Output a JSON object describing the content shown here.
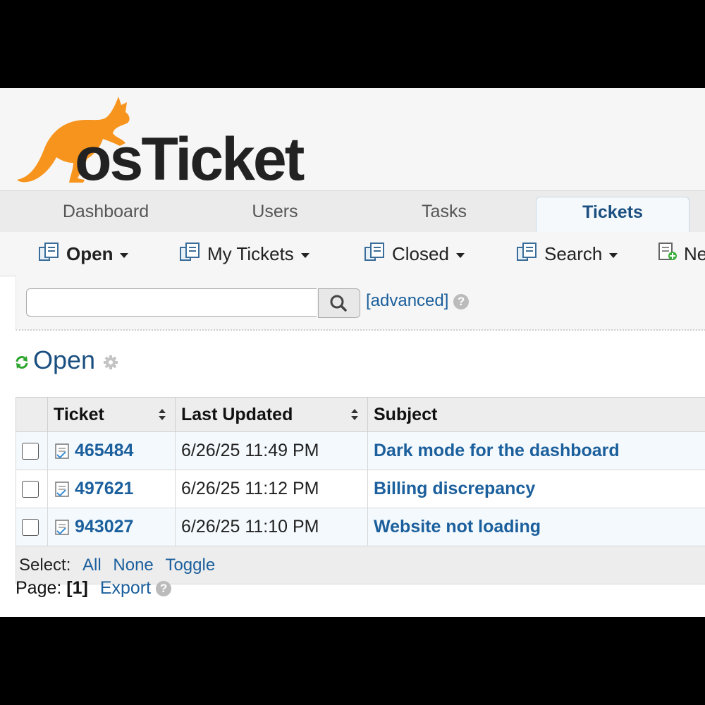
{
  "app": {
    "logo_text": "osTicket"
  },
  "tabs": [
    {
      "label": "Dashboard"
    },
    {
      "label": "Users"
    },
    {
      "label": "Tasks"
    },
    {
      "label": "Tickets",
      "active": true
    }
  ],
  "subnav": [
    {
      "label": "Open",
      "icon": "tickets-icon",
      "bold": true
    },
    {
      "label": "My Tickets",
      "icon": "tickets-icon"
    },
    {
      "label": "Closed",
      "icon": "tickets-icon"
    },
    {
      "label": "Search",
      "icon": "tickets-icon"
    },
    {
      "label": "Ne",
      "icon": "new-ticket-icon"
    }
  ],
  "search": {
    "placeholder": "",
    "advanced_label": "[advanced]",
    "help": "?"
  },
  "queue": {
    "title": "Open"
  },
  "table": {
    "columns": [
      "Ticket",
      "Last Updated",
      "Subject"
    ],
    "rows": [
      {
        "ticket": "465484",
        "updated": "6/26/25 11:49 PM",
        "subject": "Dark mode for the dashboard"
      },
      {
        "ticket": "497621",
        "updated": "6/26/25 11:12 PM",
        "subject": "Billing discrepancy"
      },
      {
        "ticket": "943027",
        "updated": "6/26/25 11:10 PM",
        "subject": "Website not loading"
      }
    ],
    "select_label": "Select:",
    "select_all": "All",
    "select_none": "None",
    "select_toggle": "Toggle"
  },
  "pager": {
    "label": "Page:",
    "current": "[1]",
    "export": "Export",
    "help": "?"
  },
  "colors": {
    "accent": "#1b5f9c",
    "brand_orange": "#f7941d"
  }
}
